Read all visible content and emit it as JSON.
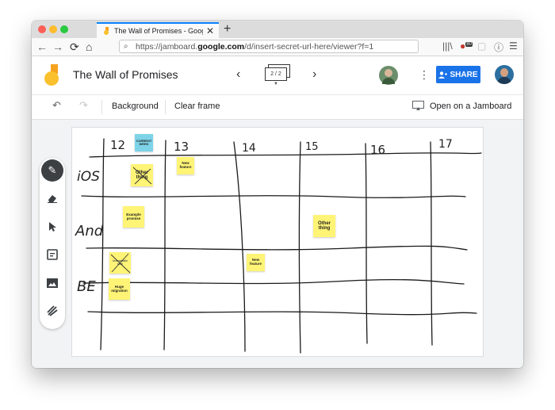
{
  "browser": {
    "tab_title": "The Wall of Promises - Google Jamboard",
    "url_prefix": "https://jamboard.",
    "url_host": "google.com",
    "url_path": "/d/insert-secret-url-here/viewer?f=1",
    "extension_badge": "80"
  },
  "app": {
    "title": "The Wall of Promises",
    "frame_indicator": "2 / 2",
    "share_label": "SHARE"
  },
  "toolbar": {
    "background_label": "Background",
    "clear_frame_label": "Clear frame",
    "open_on_jamboard_label": "Open on a Jamboard"
  },
  "board": {
    "columns": [
      "12",
      "13",
      "14",
      "15",
      "16",
      "17"
    ],
    "rows": [
      "iOS",
      "And",
      "BE"
    ],
    "notes": [
      {
        "text": "CURRENT WEEK",
        "color": "#7dd3e8"
      },
      {
        "text": "Other thing",
        "color": "#fff475",
        "crossed": true
      },
      {
        "text": "New feature",
        "color": "#fff475"
      },
      {
        "text": "Example promise",
        "color": "#fff475"
      },
      {
        "text": "Other thing",
        "color": "#fff475"
      },
      {
        "text": "Unreadable note",
        "color": "#fff475",
        "crossed": true
      },
      {
        "text": "New feature",
        "color": "#fff475"
      },
      {
        "text": "Huge migration",
        "color": "#fff475"
      }
    ]
  },
  "colors": {
    "accent": "#1a73e8",
    "sticky_yellow": "#fff475",
    "sticky_blue": "#7dd3e8"
  }
}
